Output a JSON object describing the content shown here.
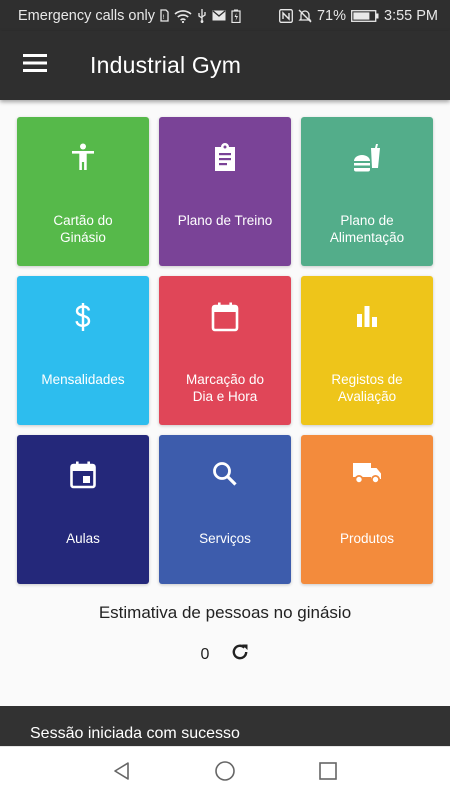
{
  "status_bar": {
    "carrier_text": "Emergency calls only",
    "battery_percent": "71%",
    "time": "3:55 PM"
  },
  "app_bar": {
    "title": "Industrial Gym",
    "menu_icon": "hamburger-menu-icon"
  },
  "tiles": [
    {
      "label": "Cartão do\nGinásio",
      "icon": "accessibility-person-icon",
      "color": "#56b94a"
    },
    {
      "label": "Plano de Treino",
      "icon": "clipboard-icon",
      "color": "#7a4397"
    },
    {
      "label": "Plano de\nAlimentação",
      "icon": "fastfood-icon",
      "color": "#53ad8a"
    },
    {
      "label": "Mensalidades",
      "icon": "dollar-icon",
      "color": "#2dbdee"
    },
    {
      "label": "Marcação do\nDia e Hora",
      "icon": "calendar-icon",
      "color": "#e04658"
    },
    {
      "label": "Registos de\nAvaliação",
      "icon": "bar-chart-icon",
      "color": "#eec51a"
    },
    {
      "label": "Aulas",
      "icon": "event-icon",
      "color": "#24287a"
    },
    {
      "label": "Serviços",
      "icon": "search-icon",
      "color": "#3d5cac"
    },
    {
      "label": "Produtos",
      "icon": "truck-icon",
      "color": "#f38b3c"
    }
  ],
  "people_estimate": {
    "title": "Estimativa de pessoas no ginásio",
    "count": "0",
    "refresh_icon": "refresh-icon"
  },
  "snackbar": {
    "message": "Sessão iniciada com sucesso"
  },
  "nav_bar": {
    "back_icon": "back-triangle-icon",
    "home_icon": "home-circle-icon",
    "recents_icon": "recents-square-icon"
  }
}
